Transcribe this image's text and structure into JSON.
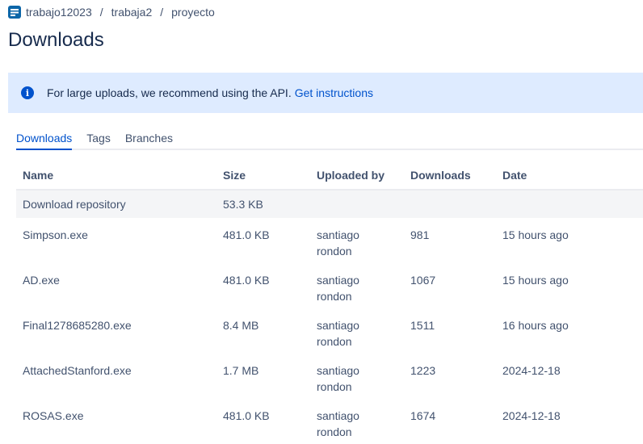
{
  "breadcrumb": {
    "icon": "repo-icon",
    "items": [
      "trabajo12023",
      "trabaja2",
      "proyecto"
    ],
    "separator": "/"
  },
  "page": {
    "title": "Downloads"
  },
  "banner": {
    "icon": "info-icon",
    "text": "For large uploads, we recommend using the API.",
    "link": "Get instructions"
  },
  "tabs": [
    {
      "label": "Downloads",
      "active": true
    },
    {
      "label": "Tags",
      "active": false
    },
    {
      "label": "Branches",
      "active": false
    }
  ],
  "table": {
    "headers": [
      "Name",
      "Size",
      "Uploaded by",
      "Downloads",
      "Date"
    ],
    "repo_row": {
      "name": "Download repository",
      "size": "53.3 KB"
    },
    "rows": [
      {
        "name": "Simpson.exe",
        "size": "481.0 KB",
        "uploader_first": "santiago",
        "uploader_last": "rondon",
        "downloads": "981",
        "date": "15 hours ago"
      },
      {
        "name": "AD.exe",
        "size": "481.0 KB",
        "uploader_first": "santiago",
        "uploader_last": "rondon",
        "downloads": "1067",
        "date": "15 hours ago"
      },
      {
        "name": "Final1278685280.exe",
        "size": "8.4 MB",
        "uploader_first": "santiago",
        "uploader_last": "rondon",
        "downloads": "1511",
        "date": "16 hours ago"
      },
      {
        "name": "AttachedStanford.exe",
        "size": "1.7 MB",
        "uploader_first": "santiago",
        "uploader_last": "rondon",
        "downloads": "1223",
        "date": "2024-12-18"
      },
      {
        "name": "ROSAS.exe",
        "size": "481.0 KB",
        "uploader_first": "santiago",
        "uploader_last": "rondon",
        "downloads": "1674",
        "date": "2024-12-18"
      }
    ]
  },
  "colors": {
    "accent": "#0052cc",
    "banner_bg": "#deebff",
    "text": "#42526e"
  }
}
